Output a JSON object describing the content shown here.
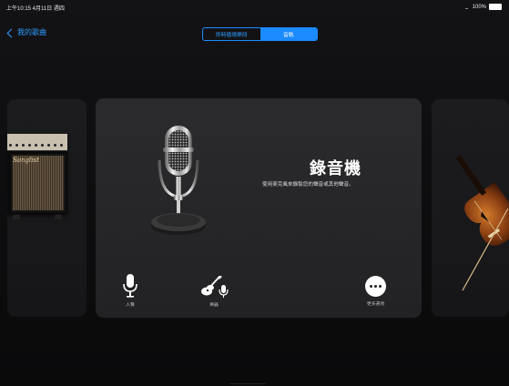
{
  "status": {
    "time_date": "上午10:15  4月11日 週四",
    "battery": "100%"
  },
  "nav": {
    "back_label": "我的歌曲"
  },
  "segment": {
    "options": [
      "即時循環樂段",
      "音軌"
    ],
    "selected": "音軌"
  },
  "recorder": {
    "title": "錄音機",
    "description": "使用麥克風來錄製您的聲音或其他聲音。",
    "options": [
      {
        "label": "人聲",
        "icon": "microphone-icon"
      },
      {
        "label": "樂器",
        "icon": "guitar-mic-icon"
      },
      {
        "label": "更多選項",
        "icon": "more-icon"
      }
    ]
  },
  "left_card": {
    "brand": "Songlist"
  },
  "colors": {
    "accent": "#1b8bff",
    "background": "#0b0b0c",
    "card": "#2b2b2d"
  }
}
